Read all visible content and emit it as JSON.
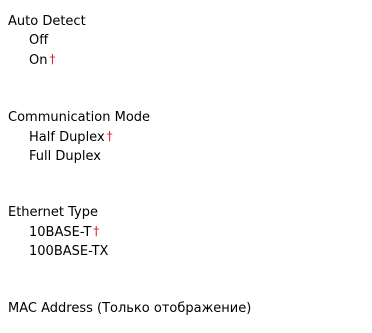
{
  "settings": [
    {
      "title": "Auto Detect",
      "options": [
        {
          "label": "Off",
          "mark": ""
        },
        {
          "label": "On",
          "mark": "†"
        }
      ]
    },
    {
      "title": "Communication Mode",
      "options": [
        {
          "label": "Half Duplex",
          "mark": "†"
        },
        {
          "label": "Full Duplex",
          "mark": ""
        }
      ]
    },
    {
      "title": "Ethernet Type",
      "options": [
        {
          "label": "10BASE-T",
          "mark": "†"
        },
        {
          "label": "100BASE-TX",
          "mark": ""
        }
      ]
    },
    {
      "title": "MAC Address (Только отображение)"
    }
  ],
  "colors": {
    "default_mark": "#e0202a",
    "text": "#000000"
  }
}
